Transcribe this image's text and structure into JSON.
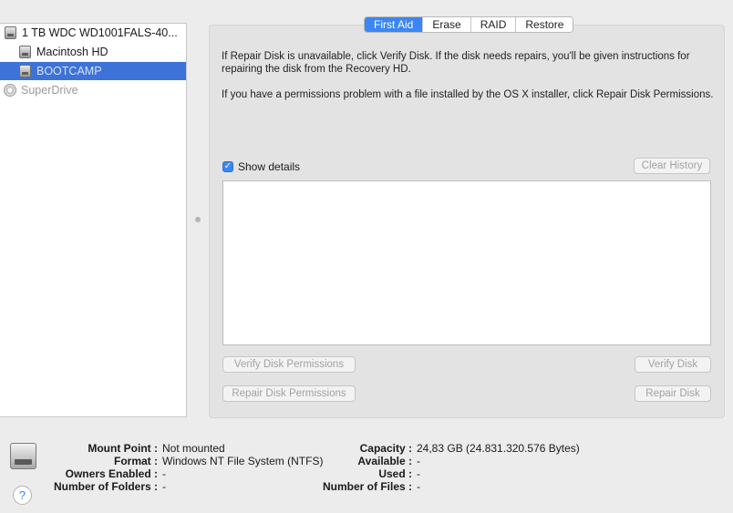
{
  "sidebar": {
    "items": [
      {
        "label": "1 TB WDC WD1001FALS-40...",
        "icon": "hard-drive-icon"
      },
      {
        "label": "Macintosh HD",
        "icon": "volume-icon"
      },
      {
        "label": "BOOTCAMP",
        "icon": "volume-icon",
        "selected": true
      },
      {
        "label": "SuperDrive",
        "icon": "optical-drive-icon"
      }
    ]
  },
  "tabs": [
    {
      "label": "First Aid",
      "active": true
    },
    {
      "label": "Erase"
    },
    {
      "label": "RAID"
    },
    {
      "label": "Restore"
    }
  ],
  "first_aid": {
    "para1": "If Repair Disk is unavailable, click Verify Disk. If the disk needs repairs, you'll be given instructions for repairing the disk from the Recovery HD.",
    "para2": "If you have a permissions problem with a file installed by the OS X installer, click Repair Disk Permissions.",
    "show_details_label": "Show details",
    "show_details_checked": true,
    "clear_history_label": "Clear History",
    "verify_permissions_label": "Verify Disk Permissions",
    "repair_permissions_label": "Repair Disk Permissions",
    "verify_disk_label": "Verify Disk",
    "repair_disk_label": "Repair Disk"
  },
  "info": {
    "mount_point_label": "Mount Point :",
    "mount_point_value": "Not mounted",
    "format_label": "Format :",
    "format_value": "Windows NT File System (NTFS)",
    "owners_enabled_label": "Owners Enabled :",
    "owners_enabled_value": "-",
    "folders_label": "Number of Folders :",
    "folders_value": "-",
    "capacity_label": "Capacity :",
    "capacity_value": "24,83 GB (24.831.320.576 Bytes)",
    "available_label": "Available :",
    "available_value": "-",
    "used_label": "Used :",
    "used_value": "-",
    "files_label": "Number of Files :",
    "files_value": "-",
    "help_label": "?"
  },
  "colors": {
    "accent": "#3a86f3",
    "selection": "#3d72d8"
  }
}
